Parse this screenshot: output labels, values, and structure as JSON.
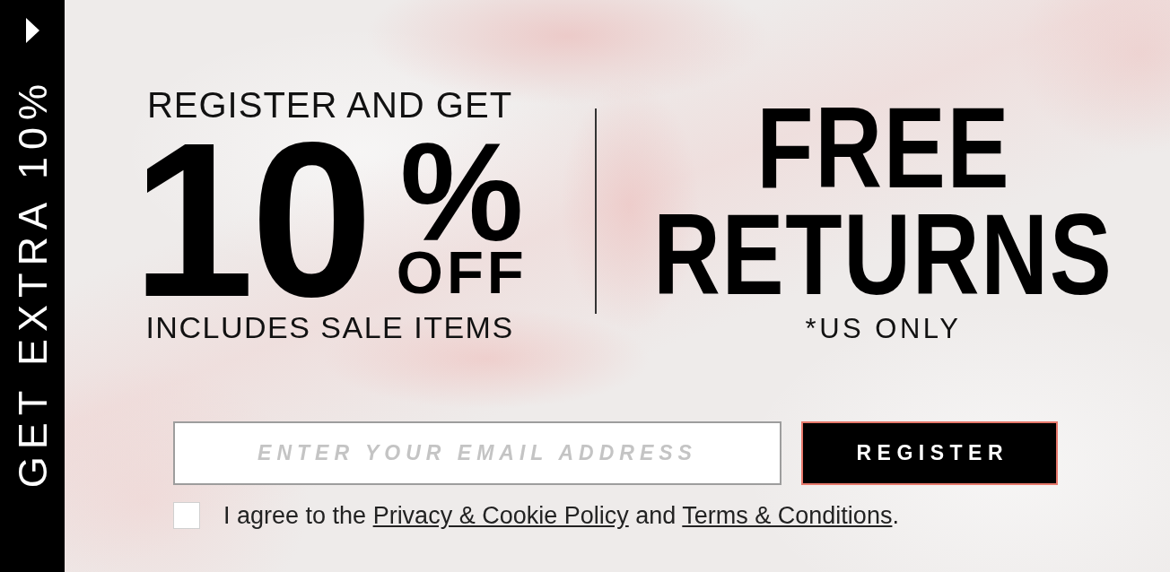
{
  "side_tab": {
    "label": "GET EXTRA 10%"
  },
  "offer": {
    "intro": "REGISTER AND GET",
    "amount": "10",
    "percent": "%",
    "off": "OFF",
    "note": "INCLUDES SALE ITEMS"
  },
  "returns": {
    "headline": [
      "FREE",
      "RETURNS"
    ],
    "note": "*US ONLY"
  },
  "form": {
    "email": {
      "placeholder": "ENTER YOUR EMAIL ADDRESS"
    },
    "submit": "REGISTER",
    "consent": {
      "checked": false,
      "segments": [
        {
          "kind": "text",
          "text": "I agree to the "
        },
        {
          "kind": "link",
          "text": "Privacy & Cookie Policy"
        },
        {
          "kind": "text",
          "text": " and "
        },
        {
          "kind": "link",
          "text": "Terms & Conditions"
        },
        {
          "kind": "text",
          "text": "."
        }
      ]
    }
  }
}
